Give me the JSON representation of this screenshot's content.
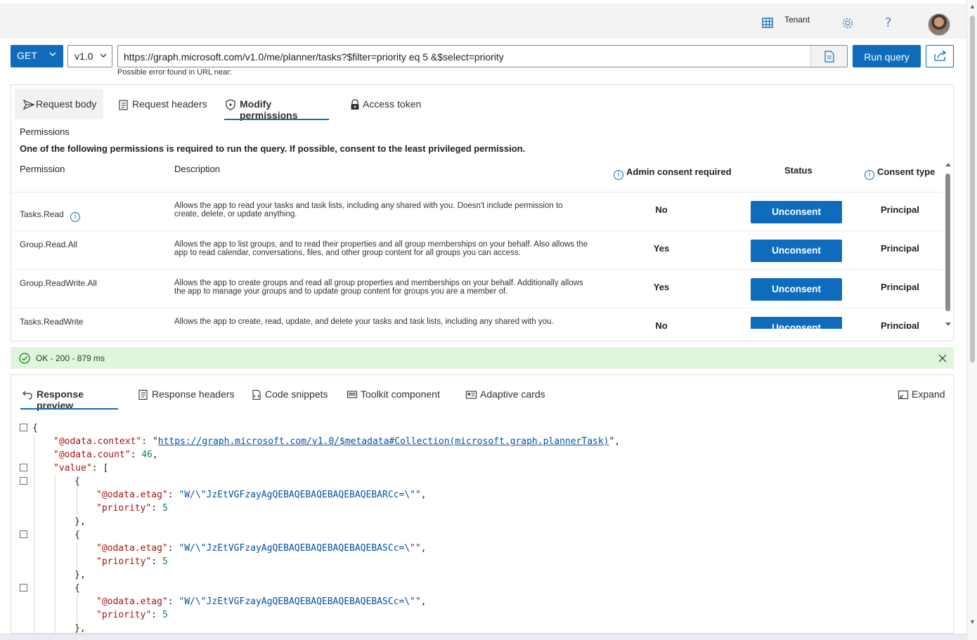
{
  "header": {
    "tenant_label": "Tenant",
    "help_glyph": "?",
    "icons": [
      "tenant-icon",
      "gear-icon",
      "help-icon",
      "avatar"
    ]
  },
  "query": {
    "method": "GET",
    "version": "v1.0",
    "url": "https://graph.microsoft.com/v1.0/me/planner/tasks?$filter=priority eq 5 &$select=priority",
    "error_hint": "Possible error found in URL near:",
    "run_label": "Run query"
  },
  "request_tabs": [
    {
      "label": "Request body"
    },
    {
      "label": "Request headers"
    },
    {
      "label": "Modify permissions"
    },
    {
      "label": "Access token"
    }
  ],
  "permissions": {
    "heading": "Permissions",
    "subheading": "One of the following permissions is required to run the query. If possible, consent to the least privileged permission.",
    "columns": {
      "permission": "Permission",
      "description": "Description",
      "admin": "Admin consent required",
      "status": "Status",
      "consent_type": "Consent type"
    },
    "rows": [
      {
        "name": "Tasks.Read",
        "description": "Allows the app to read your tasks and task lists, including any shared with you. Doesn't include permission to create, delete, or update anything.",
        "admin": "No",
        "button": "Unconsent",
        "type": "Principal"
      },
      {
        "name": "Group.Read.All",
        "description": "Allows the app to list groups, and to read their properties and all group memberships on your behalf. Also allows the app to read calendar, conversations, files, and other group content for all groups you can access.",
        "admin": "Yes",
        "button": "Unconsent",
        "type": "Principal"
      },
      {
        "name": "Group.ReadWrite.All",
        "description": "Allows the app to create groups and read all group properties and memberships on your behalf. Additionally allows the app to manage your groups and to update group content for groups you are a member of.",
        "admin": "Yes",
        "button": "Unconsent",
        "type": "Principal"
      },
      {
        "name": "Tasks.ReadWrite",
        "description": "Allows the app to create, read, update, and delete your tasks and task lists, including any shared with you.",
        "admin": "No",
        "button": "Unconsent",
        "type": "Principal"
      }
    ]
  },
  "status_bar": {
    "text": "OK - 200 - 879 ms",
    "color": "#dff6dd"
  },
  "response_tabs": [
    {
      "label": "Response preview"
    },
    {
      "label": "Response headers"
    },
    {
      "label": "Code snippets"
    },
    {
      "label": "Toolkit component"
    },
    {
      "label": "Adaptive cards"
    }
  ],
  "expand_label": "Expand",
  "response": {
    "odata_context_key": "\"@odata.context\"",
    "odata_context_value": "https://graph.microsoft.com/v1.0/$metadata#Collection(microsoft.graph.plannerTask)",
    "odata_count_key": "\"@odata.count\"",
    "odata_count_value": "46",
    "value_key": "\"value\"",
    "items": [
      {
        "etag_key": "\"@odata.etag\"",
        "etag": "\"W/\\\"JzEtVGFzayAgQEBAQEBAQEBAQEBAQEBARCc=\\\"\"",
        "priority_key": "\"priority\"",
        "priority": "5"
      },
      {
        "etag_key": "\"@odata.etag\"",
        "etag": "\"W/\\\"JzEtVGFzayAgQEBAQEBAQEBAQEBAQEBASCc=\\\"\"",
        "priority_key": "\"priority\"",
        "priority": "5"
      },
      {
        "etag_key": "\"@odata.etag\"",
        "etag": "\"W/\\\"JzEtVGFzayAgQEBAQEBAQEBAQEBAQEBASCc=\\\"\"",
        "priority_key": "\"priority\"",
        "priority": "5"
      }
    ]
  },
  "colors": {
    "accent": "#0f6cbd",
    "json_key": "#a31515",
    "json_string": "#0451a5",
    "json_number": "#098658",
    "success": "#107c10"
  }
}
